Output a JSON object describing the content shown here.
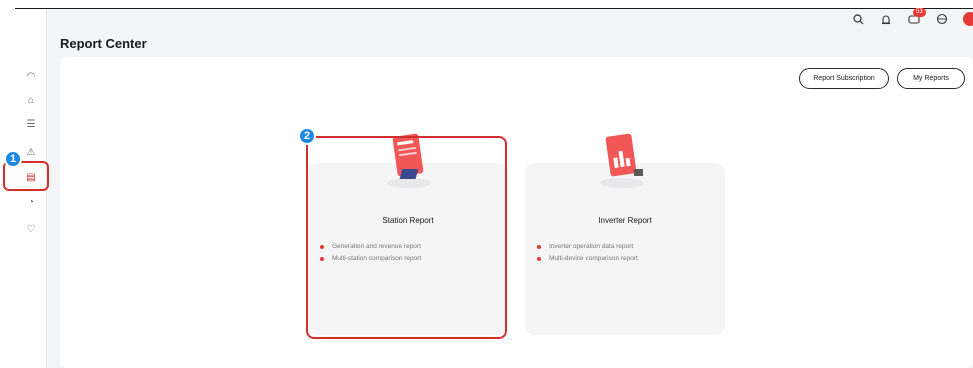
{
  "header": {
    "page_title": "Report Center",
    "notification_count": "53"
  },
  "actions": {
    "subscription_label": "Report Subscription",
    "my_reports_label": "My Reports"
  },
  "cards": [
    {
      "title": "Station Report",
      "items": [
        "Generation and revenue report",
        "Multi-station comparison report"
      ]
    },
    {
      "title": "Inverter Report",
      "items": [
        "Inverter operation data report",
        "Multi-device comparison report"
      ]
    }
  ],
  "callouts": [
    "1",
    "2"
  ],
  "colors": {
    "accent": "#e53935",
    "callout": "#1e88e5",
    "highlight": "#d32f2f"
  },
  "icons": [
    "search-icon",
    "alarm-icon",
    "message-icon",
    "globe-icon",
    "avatar"
  ]
}
